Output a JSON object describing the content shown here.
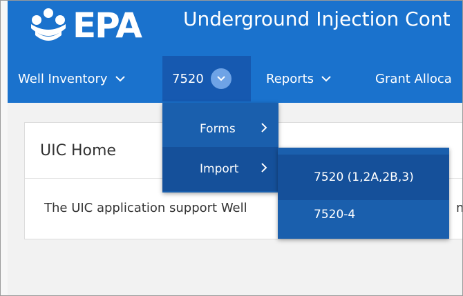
{
  "header": {
    "logo_text": "EPA",
    "app_title": "Underground Injection Cont"
  },
  "nav": {
    "items": [
      {
        "label": "Well Inventory"
      },
      {
        "label": "7520"
      },
      {
        "label": "Reports"
      },
      {
        "label": "Grant Alloca"
      }
    ]
  },
  "menu_7520": {
    "items": [
      {
        "label": "Forms"
      },
      {
        "label": "Import"
      }
    ]
  },
  "submenu_import": {
    "items": [
      {
        "label": "7520 (1,2A,2B,3)"
      },
      {
        "label": "7520-4"
      }
    ]
  },
  "panel": {
    "title": "UIC Home",
    "body": "The UIC application support Well",
    "body_tail": "m"
  },
  "colors": {
    "header_blue": "#1a72cd",
    "menu_blue": "#1a5fad",
    "active_blue": "#1659b0"
  }
}
